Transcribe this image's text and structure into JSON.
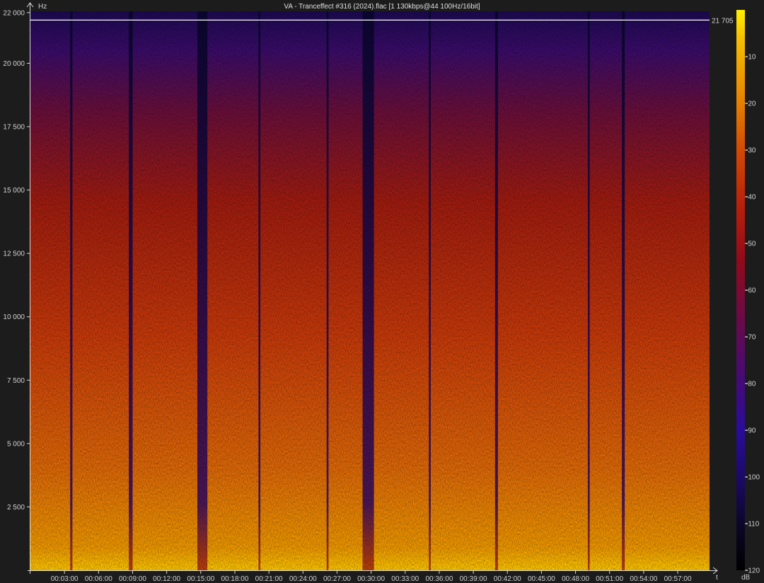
{
  "chart_data": {
    "type": "heatmap",
    "title": "VA - Tranceffect #316 (2024).flac [1 130kbps@44 100Hz/16bit]",
    "ylabel": "Hz",
    "xlabel": "t",
    "colorbar_label": "dB",
    "ylim": [
      0,
      22050
    ],
    "xlim_seconds": [
      0,
      3588
    ],
    "y_ticks": [
      {
        "value": 2500,
        "label": "2 500"
      },
      {
        "value": 5000,
        "label": "5 000"
      },
      {
        "value": 7500,
        "label": "7 500"
      },
      {
        "value": 10000,
        "label": "10 000"
      },
      {
        "value": 12500,
        "label": "12 500"
      },
      {
        "value": 15000,
        "label": "15 000"
      },
      {
        "value": 17500,
        "label": "17 500"
      },
      {
        "value": 20000,
        "label": "20 000"
      },
      {
        "value": 22000,
        "label": "22 000"
      }
    ],
    "x_ticks": [
      {
        "value": 180,
        "label": "00:03:00"
      },
      {
        "value": 360,
        "label": "00:06:00"
      },
      {
        "value": 540,
        "label": "00:09:00"
      },
      {
        "value": 720,
        "label": "00:12:00"
      },
      {
        "value": 900,
        "label": "00:15:00"
      },
      {
        "value": 1080,
        "label": "00:18:00"
      },
      {
        "value": 1260,
        "label": "00:21:00"
      },
      {
        "value": 1440,
        "label": "00:24:00"
      },
      {
        "value": 1620,
        "label": "00:27:00"
      },
      {
        "value": 1800,
        "label": "00:30:00"
      },
      {
        "value": 1980,
        "label": "00:33:00"
      },
      {
        "value": 2160,
        "label": "00:36:00"
      },
      {
        "value": 2340,
        "label": "00:39:00"
      },
      {
        "value": 2520,
        "label": "00:42:00"
      },
      {
        "value": 2700,
        "label": "00:45:00"
      },
      {
        "value": 2880,
        "label": "00:48:00"
      },
      {
        "value": 3060,
        "label": "00:51:00"
      },
      {
        "value": 3240,
        "label": "00:54:00"
      },
      {
        "value": 3420,
        "label": "00:57:00"
      }
    ],
    "cutoff_line": {
      "value": 21705,
      "label": "21 705"
    },
    "colorbar_range": [
      -120,
      0
    ],
    "colorbar_ticks": [
      {
        "value": -10,
        "label": "-10"
      },
      {
        "value": -20,
        "label": "-20"
      },
      {
        "value": -30,
        "label": "-30"
      },
      {
        "value": -40,
        "label": "-40"
      },
      {
        "value": -50,
        "label": "-50"
      },
      {
        "value": -60,
        "label": "-60"
      },
      {
        "value": -70,
        "label": "-70"
      },
      {
        "value": -80,
        "label": "-80"
      },
      {
        "value": -90,
        "label": "-90"
      },
      {
        "value": -100,
        "label": "-100"
      },
      {
        "value": -110,
        "label": "-110"
      },
      {
        "value": -120,
        "label": "-120"
      }
    ],
    "dark_bands_seconds": [
      {
        "start": 882,
        "end": 935
      },
      {
        "start": 1755,
        "end": 1815
      },
      {
        "start": 210,
        "end": 222
      },
      {
        "start": 520,
        "end": 540
      },
      {
        "start": 1205,
        "end": 1215
      },
      {
        "start": 1565,
        "end": 1575
      },
      {
        "start": 2105,
        "end": 2115
      },
      {
        "start": 2455,
        "end": 2470
      },
      {
        "start": 2945,
        "end": 2955
      },
      {
        "start": 3125,
        "end": 3140
      }
    ],
    "colors": {
      "background": "#1c1c1c",
      "axis": "#d8d8d8",
      "cutoff_line": "#ffffff",
      "colormap": [
        "#000000",
        "#14083a",
        "#2a0f8a",
        "#4a0a6e",
        "#7a0a30",
        "#b21808",
        "#d84a06",
        "#f08c00",
        "#ffd400"
      ]
    }
  }
}
